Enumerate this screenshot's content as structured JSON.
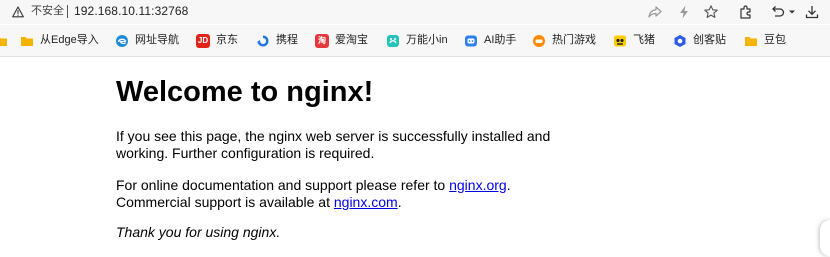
{
  "address_bar": {
    "insecure_label": "不安全",
    "url": "192.168.10.11:32768"
  },
  "bookmarks": [
    {
      "label": "从Edge导入",
      "icon": "folder-icon",
      "color": "#f4b400"
    },
    {
      "label": "网址导航",
      "icon": "edge-icon",
      "color": "#1a8cd8"
    },
    {
      "label": "京东",
      "icon": "jd-icon",
      "color": "#e1251b",
      "icon_text": "JD"
    },
    {
      "label": "携程",
      "icon": "ctrip-icon",
      "color": "#2577e3"
    },
    {
      "label": "爱淘宝",
      "icon": "taobao-icon",
      "color": "#e4393c",
      "icon_text": "淘"
    },
    {
      "label": "万能小in",
      "icon": "wanneng-icon",
      "color": "#27c2b8"
    },
    {
      "label": "AI助手",
      "icon": "ai-assistant-icon",
      "color": "#2f80ed"
    },
    {
      "label": "热门游戏",
      "icon": "game-icon",
      "color": "#ff8a00"
    },
    {
      "label": "飞猪",
      "icon": "fliggy-icon",
      "color": "#ffcc00"
    },
    {
      "label": "创客贴",
      "icon": "chuangketie-icon",
      "color": "#2d5be3"
    },
    {
      "label": "豆包",
      "icon": "folder-icon",
      "color": "#f4b400"
    }
  ],
  "page": {
    "title": "Welcome to nginx!",
    "p1": "If you see this page, the nginx web server is successfully installed and working. Further configuration is required.",
    "p2_before": "For online documentation and support please refer to ",
    "p2_link1": "nginx.org",
    "p2_mid": ". Commercial support is available at ",
    "p2_link2": "nginx.com",
    "p2_after": ".",
    "p3": "Thank you for using nginx."
  }
}
